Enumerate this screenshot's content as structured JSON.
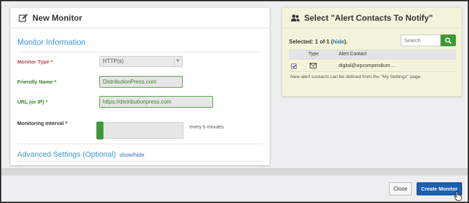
{
  "left_panel": {
    "title": "New Monitor",
    "section_title": "Monitor Information",
    "monitor_type": {
      "label": "Monitor Type",
      "required": "*",
      "value": "HTTP(s)"
    },
    "friendly_name": {
      "label": "Friendly Name",
      "required": "*",
      "value": "DistributionPress.com"
    },
    "url": {
      "label": "URL (or IP)",
      "required": "*",
      "value": "https://distributionpress.com"
    },
    "interval": {
      "label": "Monitoring Interval",
      "required": "*",
      "note": "every 5 minutes",
      "level": 0
    },
    "advanced": {
      "label": "Advanced Settings (Optional)",
      "toggle": "show/hide"
    }
  },
  "right_panel": {
    "title": "Select \"Alert Contacts To Notify\"",
    "selected_prefix": "Selected: 1 of 1 (",
    "selected_link": "hide",
    "selected_suffix": ").",
    "search_placeholder": "Search",
    "columns": [
      "Type",
      "Alert Contact"
    ],
    "rows": [
      {
        "checked": true,
        "type_icon": "envelope-icon",
        "contact": "digital@wpcompendium...."
      }
    ],
    "note": "New alert contacts can be defined from the \"My Settings\" page."
  },
  "footer": {
    "close_label": "Close",
    "create_label": "Create Monitor"
  },
  "colors": {
    "accent_blue": "#3a9ad9",
    "primary_button": "#1a5fb4",
    "success_green": "#3c9a36",
    "right_panel_bg": "#f4f4dc"
  }
}
